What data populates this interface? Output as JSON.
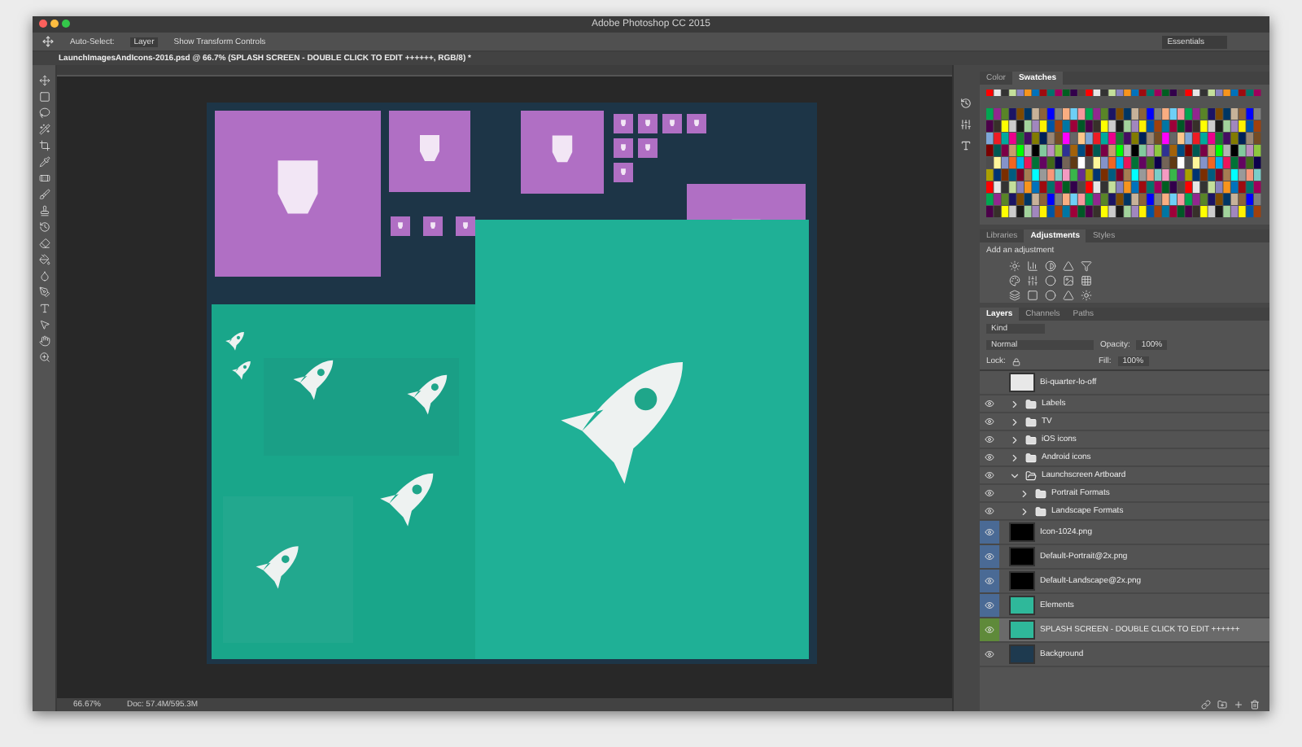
{
  "window": {
    "title": "Adobe Photoshop CC 2015"
  },
  "options_bar": {
    "items": [
      {
        "label": "Auto-Select:",
        "kind": "label"
      },
      {
        "label": "Layer",
        "kind": "dropdown"
      },
      {
        "label": "Show Transform Controls",
        "kind": "label"
      }
    ],
    "workspace": "Essentials"
  },
  "document_tab": {
    "title": "LaunchImagesAndIcons-2016.psd @ 66.7% (SPLASH SCREEN - DOUBLE CLICK TO EDIT ++++++, RGB/8) *"
  },
  "swatches_panel": {
    "tabs": [
      {
        "label": "Color",
        "selected": false
      },
      {
        "label": "Swatches",
        "selected": true
      }
    ]
  },
  "adjustments_panel": {
    "tabs": [
      {
        "label": "Libraries",
        "selected": false
      },
      {
        "label": "Adjustments",
        "selected": true
      },
      {
        "label": "Styles",
        "selected": false
      }
    ],
    "hint": "Add an adjustment"
  },
  "layers_panel": {
    "tabs": [
      {
        "label": "Layers",
        "selected": true
      },
      {
        "label": "Channels",
        "selected": false
      },
      {
        "label": "Paths",
        "selected": false
      }
    ],
    "filter": "Kind",
    "blend_mode": "Normal",
    "opacity_label": "Opacity:",
    "opacity": "100%",
    "lock_label": "Lock:",
    "fill_label": "Fill:",
    "fill": "100%",
    "layers": [
      {
        "name": "Bi-quarter-lo-off",
        "kind": "layer",
        "visible": false,
        "selected": false,
        "active": false
      },
      {
        "name": "Labels",
        "kind": "folder",
        "visible": true,
        "selected": false,
        "active": false,
        "expanded": false
      },
      {
        "name": "TV",
        "kind": "folder",
        "visible": true,
        "selected": false,
        "active": false,
        "expanded": false
      },
      {
        "name": "iOS icons",
        "kind": "folder",
        "visible": true,
        "selected": false,
        "active": false,
        "expanded": false
      },
      {
        "name": "Android icons",
        "kind": "folder",
        "visible": true,
        "selected": false,
        "active": false,
        "expanded": false
      },
      {
        "name": "Launchscreen Artboard",
        "kind": "folder",
        "visible": true,
        "selected": false,
        "active": false,
        "expanded": true,
        "children": [
          {
            "name": "Portrait Formats",
            "kind": "folder",
            "visible": true,
            "selected": false,
            "active": false,
            "expanded": false
          },
          {
            "name": "Landscape Formats",
            "kind": "folder",
            "visible": true,
            "selected": false,
            "active": false,
            "expanded": false
          }
        ]
      },
      {
        "name": "Icon-1024.png",
        "kind": "mask",
        "visible": true,
        "selected": true,
        "active": false
      },
      {
        "name": "Default-Portrait@2x.png",
        "kind": "mask",
        "visible": true,
        "selected": true,
        "active": false
      },
      {
        "name": "Default-Landscape@2x.png",
        "kind": "mask",
        "visible": true,
        "selected": true,
        "active": false
      },
      {
        "name": "Elements",
        "kind": "image",
        "visible": true,
        "selected": true,
        "active": false
      },
      {
        "name": "SPLASH SCREEN - DOUBLE CLICK TO EDIT ++++++",
        "kind": "image",
        "visible": true,
        "selected": false,
        "active": true
      },
      {
        "name": "Background",
        "kind": "dark",
        "visible": true,
        "selected": false,
        "active": false
      }
    ]
  },
  "status_bar": {
    "zoom": "66.67%",
    "doc": "Doc: 57.4M/595.3M"
  }
}
